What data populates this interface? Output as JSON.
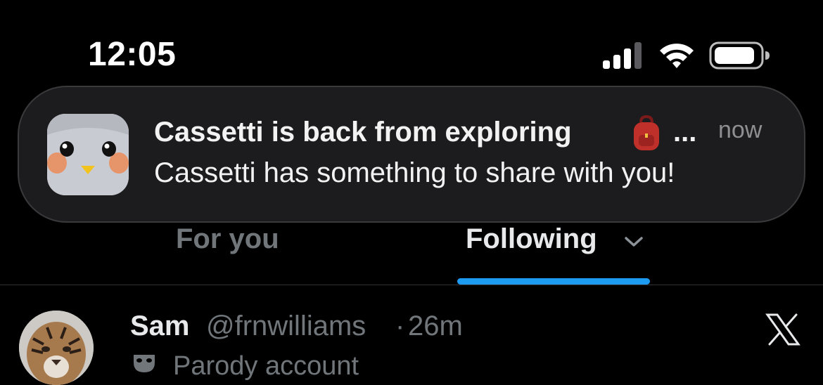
{
  "status_bar": {
    "time": "12:05",
    "icons": [
      "signal-icon",
      "wifi-icon",
      "battery-icon"
    ]
  },
  "notification": {
    "app_icon": "penguin-app-icon",
    "title": "Cassetti is back from exploring",
    "title_emoji_icon": "backpack-icon",
    "ellipsis": "...",
    "time": "now",
    "body": "Cassetti has something to share with you!"
  },
  "tabs": {
    "items": [
      {
        "label": "For you",
        "active": false
      },
      {
        "label": "Following",
        "active": true
      }
    ],
    "following_icon": "chevron-down-icon"
  },
  "tweet": {
    "name": "Sam",
    "handle": "@frnwilliams",
    "separator": "·",
    "time": "26m",
    "parody_label": "Parody account",
    "platform_icon": "x-logo-icon"
  },
  "colors": {
    "background": "#000000",
    "accent": "#1d9bf0",
    "muted_text": "#71767b",
    "notification_bg": "#1c1c1e"
  }
}
